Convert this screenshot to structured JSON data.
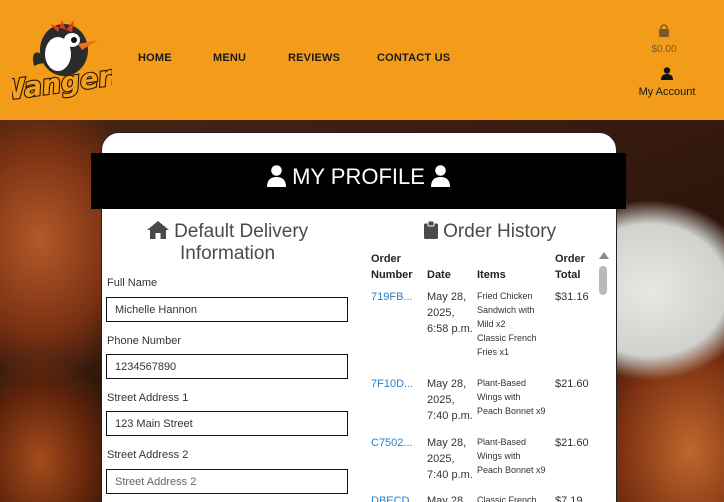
{
  "header": {
    "logo_text": "Wangers",
    "nav": [
      {
        "label": "HOME"
      },
      {
        "label": "MENU"
      },
      {
        "label": "REVIEWS"
      },
      {
        "label": "CONTACT US"
      }
    ],
    "cart_total": "$0.00",
    "account_label": "My Account",
    "brand_color": "#f39c19"
  },
  "profile": {
    "title": "MY PROFILE"
  },
  "delivery": {
    "heading_line1": "Default Delivery",
    "heading_line2": "Information",
    "fields": [
      {
        "label": "Full Name",
        "value": "Michelle Hannon",
        "placeholder": ""
      },
      {
        "label": "Phone Number",
        "value": "1234567890",
        "placeholder": ""
      },
      {
        "label": "Street Address 1",
        "value": "123 Main Street",
        "placeholder": ""
      },
      {
        "label": "Street Address 2",
        "value": "",
        "placeholder": "Street Address 2"
      }
    ]
  },
  "orders": {
    "heading": "Order History",
    "columns": [
      "Order\nNumber",
      "Date",
      "Items",
      "Order\nTotal"
    ],
    "rows": [
      {
        "number": "719FB...",
        "date": "May 28,\n2025,\n6:58 p.m.",
        "items": "Fried Chicken\nSandwich with\nMild x2\nClassic French\nFries x1",
        "total": "$31.16"
      },
      {
        "number": "7F10D...",
        "date": "May 28,\n2025,\n7:40 p.m.",
        "items": "Plant-Based\nWings with\nPeach Bonnet x9",
        "total": "$21.60"
      },
      {
        "number": "C7502...",
        "date": "May 28,\n2025,\n7:40 p.m.",
        "items": "Plant-Based\nWings with\nPeach Bonnet x9",
        "total": "$21.60"
      },
      {
        "number": "DBECD...",
        "date": "May 28,",
        "items": "Classic French",
        "total": "$7.19"
      }
    ]
  }
}
